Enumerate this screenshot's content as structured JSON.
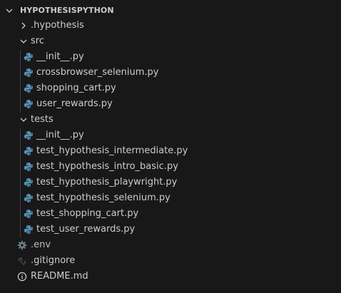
{
  "explorer": {
    "section_title": "HYPOTHESISPYTHON",
    "colors": {
      "background": "#181818",
      "text": "#cccccc",
      "python_icon_blue": "#519aba",
      "python_icon_yellow": "#e2c55b",
      "info_icon": "#cccccc",
      "gear_icon": "#6d8086"
    },
    "tree": {
      "hypothesis_folder": {
        "label": ".hypothesis",
        "expanded": false
      },
      "src_folder": {
        "label": "src",
        "expanded": true,
        "files": [
          {
            "label": "__init__.py",
            "icon": "python-file-icon"
          },
          {
            "label": "crossbrowser_selenium.py",
            "icon": "python-file-icon"
          },
          {
            "label": "shopping_cart.py",
            "icon": "python-file-icon"
          },
          {
            "label": "user_rewards.py",
            "icon": "python-file-icon"
          }
        ]
      },
      "tests_folder": {
        "label": "tests",
        "expanded": true,
        "files": [
          {
            "label": "__init__.py",
            "icon": "python-file-icon"
          },
          {
            "label": "test_hypothesis_intermediate.py",
            "icon": "python-file-icon"
          },
          {
            "label": "test_hypothesis_intro_basic.py",
            "icon": "python-file-icon"
          },
          {
            "label": "test_hypothesis_playwright.py",
            "icon": "python-file-icon"
          },
          {
            "label": "test_hypothesis_selenium.py",
            "icon": "python-file-icon"
          },
          {
            "label": "test_shopping_cart.py",
            "icon": "python-file-icon"
          },
          {
            "label": "test_user_rewards.py",
            "icon": "python-file-icon"
          }
        ]
      },
      "root_files": [
        {
          "label": ".env",
          "icon": "gear-icon"
        },
        {
          "label": ".gitignore",
          "icon": "git-icon"
        },
        {
          "label": "README.md",
          "icon": "info-icon"
        }
      ]
    }
  }
}
